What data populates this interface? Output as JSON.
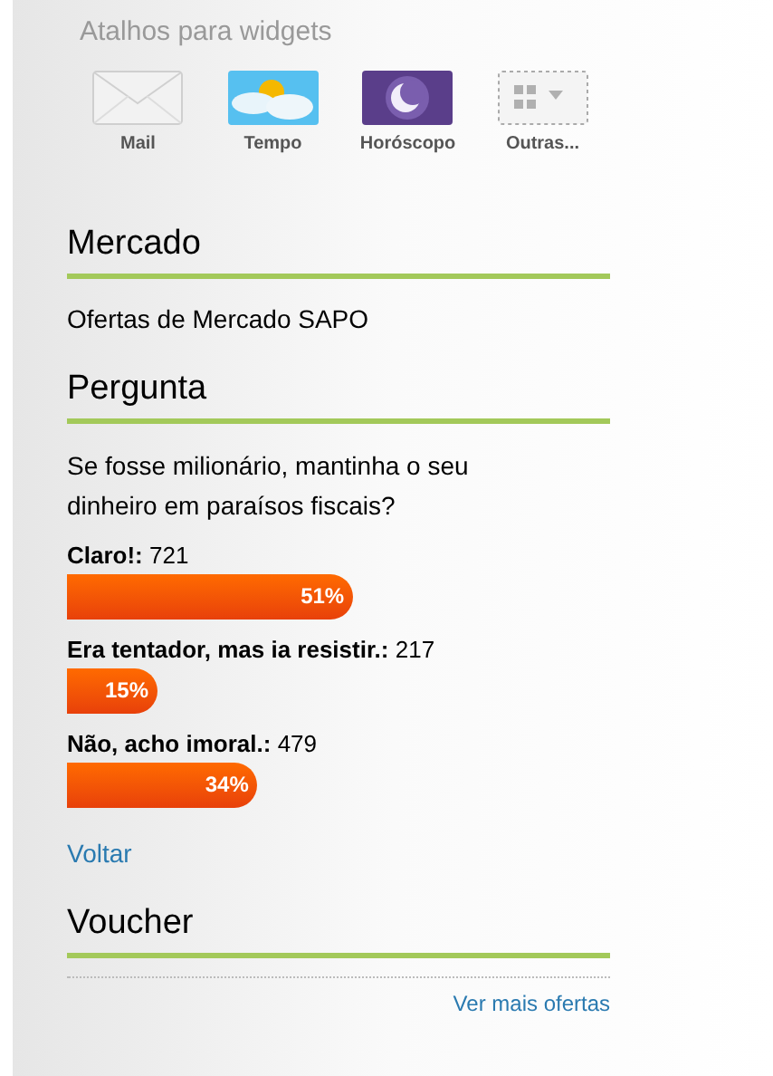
{
  "widgets": {
    "title": "Atalhos para widgets",
    "items": [
      {
        "kind": "mail",
        "label": "Mail"
      },
      {
        "kind": "weather",
        "label": "Tempo"
      },
      {
        "kind": "horoscope",
        "label": "Horóscopo"
      },
      {
        "kind": "more",
        "label": "Outras..."
      }
    ]
  },
  "market": {
    "title": "Mercado",
    "text": "Ofertas de Mercado SAPO"
  },
  "poll": {
    "title": "Pergunta",
    "question": "Se fosse milionário, mantinha o seu dinheiro em paraísos fiscais?",
    "options": [
      {
        "label": "Claro!:",
        "count": "721",
        "percent": "51%"
      },
      {
        "label": "Era tentador, mas ia resistir.:",
        "count": "217",
        "percent": "15%"
      },
      {
        "label": "Não, acho imoral.:",
        "count": "479",
        "percent": "34%"
      }
    ],
    "back_link": "Voltar"
  },
  "voucher": {
    "title": "Voucher",
    "link": "Ver mais ofertas"
  }
}
